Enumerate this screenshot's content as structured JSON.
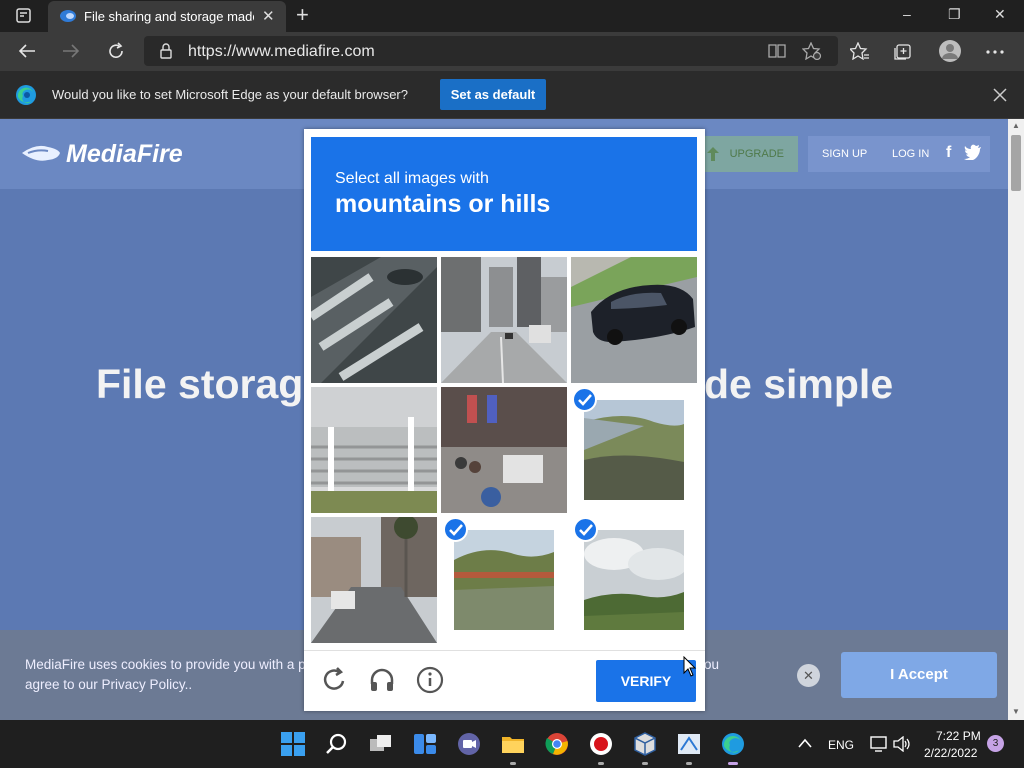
{
  "browser": {
    "tab_title": "File sharing and storage made si",
    "tab_close": "✕",
    "new_tab": "+",
    "url": "https://www.mediafire.com",
    "window_controls": [
      "–",
      "❐",
      "✕"
    ]
  },
  "infobar": {
    "message": "Would you like to set Microsoft Edge as your default browser?",
    "button_label": "Set as default"
  },
  "site": {
    "logo_text": "MediaFire",
    "upgrade_label": "UPGRADE",
    "signup_label": "SIGN UP",
    "login_label": "LOG IN",
    "facebook_icon": "f",
    "headline_left": "File storag",
    "headline_right": "de simple",
    "cookie_line1": "MediaFire uses cookies to provide you with a p",
    "cookie_line2": "agree to our Privacy Policy..",
    "cookie_tail": "ou",
    "cookie_close": "✕",
    "accept_label": "I Accept"
  },
  "captcha": {
    "prompt_line1": "Select all images with",
    "prompt_line2": "mountains or hills",
    "verify_label": "VERIFY",
    "tiles": [
      {
        "subject": "crosswalk",
        "selected": false
      },
      {
        "subject": "city-street",
        "selected": false
      },
      {
        "subject": "parked-car",
        "selected": false
      },
      {
        "subject": "stairs",
        "selected": false
      },
      {
        "subject": "busy-street",
        "selected": false
      },
      {
        "subject": "hillside",
        "selected": true
      },
      {
        "subject": "palm-street",
        "selected": false
      },
      {
        "subject": "road-hills",
        "selected": true
      },
      {
        "subject": "cloudy-hills",
        "selected": true
      }
    ]
  },
  "taskbar": {
    "language": "ENG",
    "time": "7:22 PM",
    "date": "2/22/2022",
    "notification_count": "3"
  },
  "colors": {
    "captcha_blue": "#1a73e8",
    "edge_button": "#1a6fc6",
    "page_overlay": "#5c79b3"
  }
}
